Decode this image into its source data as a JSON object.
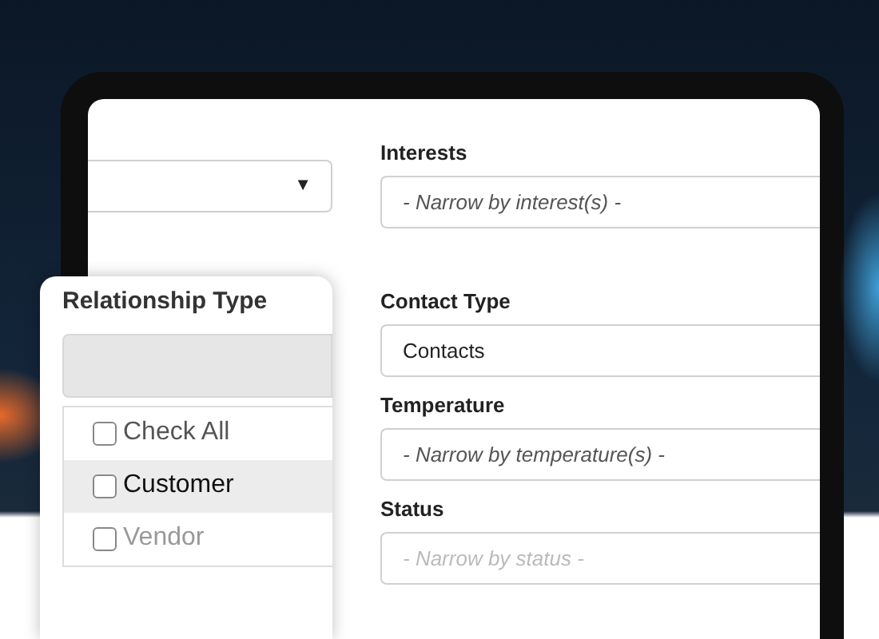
{
  "left_select": {
    "caret": "▼"
  },
  "filters": [
    {
      "label": "Interests",
      "placeholder": "- Narrow by interest(s) -"
    },
    {
      "label": "Contact Type",
      "value": "Contacts"
    },
    {
      "label": "Temperature",
      "placeholder": "- Narrow by temperature(s) -"
    },
    {
      "label": "Status",
      "placeholder": "- Narrow by status -"
    }
  ],
  "relationship_popup": {
    "title": "Relationship Type",
    "options": [
      {
        "label": "Check All",
        "checked": false,
        "selected": false
      },
      {
        "label": "Customer",
        "checked": false,
        "selected": true
      },
      {
        "label": "Vendor",
        "checked": false,
        "selected": false
      }
    ]
  }
}
